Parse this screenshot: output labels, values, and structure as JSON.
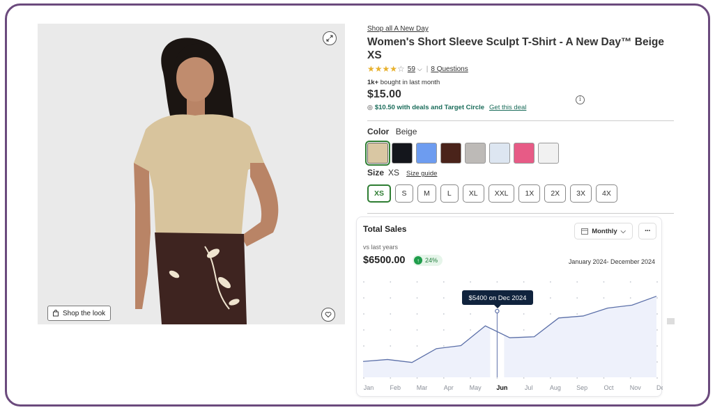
{
  "product": {
    "brand_link": "Shop all A New Day",
    "title": "Women's Short Sleeve Sculpt T-Shirt - A New Day™ Beige XS",
    "rating_stars": 4.5,
    "rating_count": "59",
    "questions": "8 Questions",
    "bought_bold": "1k+",
    "bought_rest": " bought in last month",
    "price": "$15.00",
    "deal_text": "$10.50 with deals and Target Circle",
    "get_deal": "Get this deal",
    "color_label": "Color",
    "color_value": "Beige",
    "size_label": "Size",
    "size_value": "XS",
    "size_guide": "Size guide",
    "shop_the_look": "Shop the look"
  },
  "swatches": [
    {
      "name": "Beige",
      "color": "#d9c7a3"
    },
    {
      "name": "Black",
      "color": "#14161c"
    },
    {
      "name": "Blue",
      "color": "#6d9cf0"
    },
    {
      "name": "Brown",
      "color": "#4a231a"
    },
    {
      "name": "Gray",
      "color": "#bdbab7"
    },
    {
      "name": "Light Blue",
      "color": "#dde6f1"
    },
    {
      "name": "Pink",
      "color": "#e75b86"
    },
    {
      "name": "White",
      "color": "#f1f1f1"
    }
  ],
  "sizes": [
    "XS",
    "S",
    "M",
    "L",
    "XL",
    "XXL",
    "1X",
    "2X",
    "3X",
    "4X"
  ],
  "selected_size": "XS",
  "sales_card": {
    "title": "Total Sales",
    "period_button": "Monthly",
    "vs_label": "vs last years",
    "total": "$6500.00",
    "change": "24%",
    "range": "January 2024- December 2024",
    "tooltip": "$5400 on Dec 2024"
  },
  "chart_data": {
    "type": "area",
    "categories": [
      "Jan",
      "Feb",
      "Mar",
      "Apr",
      "May",
      "Jun",
      "Jul",
      "Aug",
      "Sep",
      "Oct",
      "Nov",
      "Dec"
    ],
    "highlighted_category": "Jun",
    "series": [
      {
        "values": [
          16,
          18,
          15,
          29,
          32,
          52,
          40,
          41,
          60,
          62,
          70,
          73,
          82
        ]
      }
    ],
    "ylim": [
      0,
      100
    ],
    "grid": "dotted",
    "accent_color": "#5b6fa8",
    "fill_color": "#eef1fb"
  }
}
